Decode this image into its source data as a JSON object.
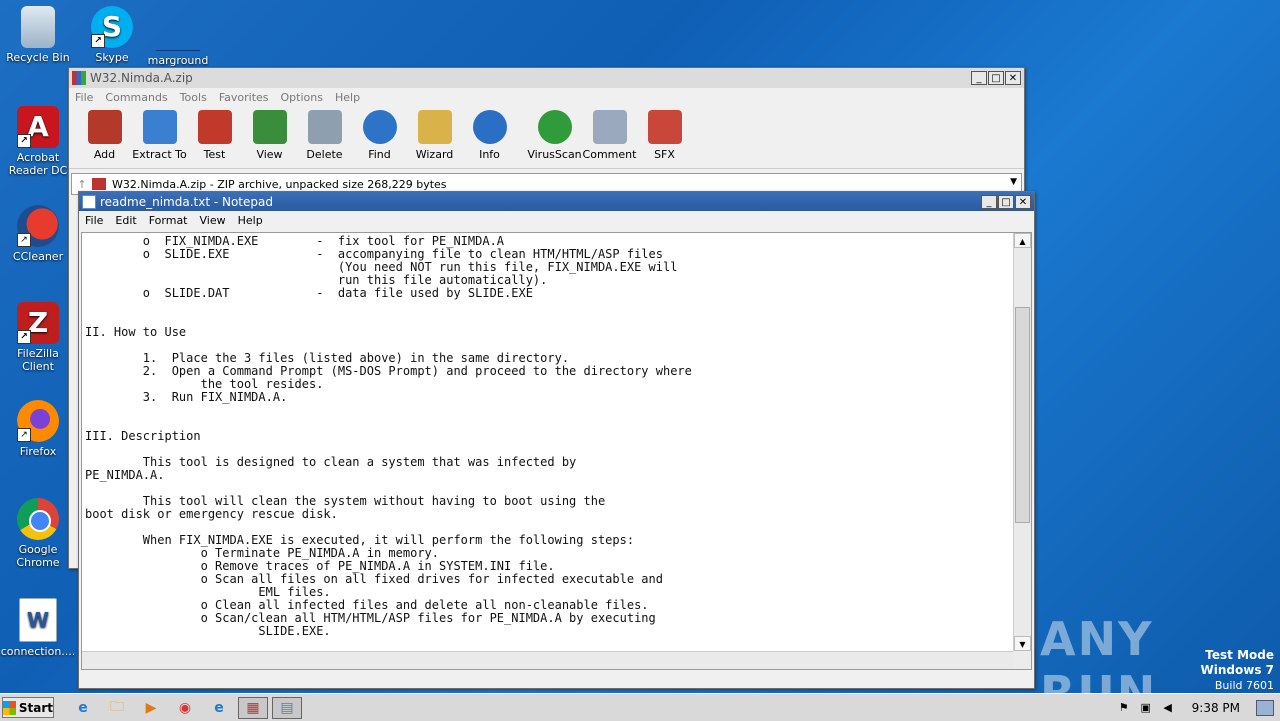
{
  "desktop_icons": [
    {
      "label": "Recycle Bin",
      "icon": "recycle-bin-icon"
    },
    {
      "label": "Skype",
      "icon": "skype-icon"
    },
    {
      "label": "marground",
      "icon": "file-icon"
    },
    {
      "label": "Acrobat Reader DC",
      "icon": "acrobat-icon"
    },
    {
      "label": "CCleaner",
      "icon": "ccleaner-icon"
    },
    {
      "label": "FileZilla Client",
      "icon": "filezilla-icon"
    },
    {
      "label": "Firefox",
      "icon": "firefox-icon"
    },
    {
      "label": "Google Chrome",
      "icon": "chrome-icon"
    },
    {
      "label": "connection....",
      "icon": "word-document-icon"
    }
  ],
  "winrar": {
    "title": "W32.Nimda.A.zip",
    "menu": [
      "File",
      "Commands",
      "Tools",
      "Favorites",
      "Options",
      "Help"
    ],
    "tools": [
      {
        "label": "Add",
        "color": "#b33a2b"
      },
      {
        "label": "Extract To",
        "color": "#3b7fd1"
      },
      {
        "label": "Test",
        "color": "#c0392b"
      },
      {
        "label": "View",
        "color": "#3a8d3a"
      },
      {
        "label": "Delete",
        "color": "#8ea0b0"
      },
      {
        "label": "Find",
        "color": "#2d74c9"
      },
      {
        "label": "Wizard",
        "color": "#d9b24a"
      },
      {
        "label": "Info",
        "color": "#2a6fc4"
      },
      {
        "label": "VirusScan",
        "color": "#2f9b3a"
      },
      {
        "label": "Comment",
        "color": "#9aa9bd"
      },
      {
        "label": "SFX",
        "color": "#c9463a"
      }
    ],
    "address": "W32.Nimda.A.zip - ZIP archive, unpacked size 268,229 bytes"
  },
  "notepad": {
    "title": "readme_nimda.txt - Notepad",
    "menu": [
      "File",
      "Edit",
      "Format",
      "View",
      "Help"
    ],
    "content": "        o  FIX_NIMDA.EXE        -  fix tool for PE_NIMDA.A\n        o  SLIDE.EXE            -  accompanying file to clean HTM/HTML/ASP files\n                                   (You need NOT run this file, FIX_NIMDA.EXE will\n                                   run this file automatically).\n        o  SLIDE.DAT            -  data file used by SLIDE.EXE\n\n\nII. How to Use\n\n        1.  Place the 3 files (listed above) in the same directory.\n        2.  Open a Command Prompt (MS-DOS Prompt) and proceed to the directory where\n                the tool resides.\n        3.  Run FIX_NIMDA.A.\n\n\nIII. Description\n\n        This tool is designed to clean a system that was infected by\nPE_NIMDA.A.\n\n        This tool will clean the system without having to boot using the\nboot disk or emergency rescue disk.\n\n        When FIX_NIMDA.EXE is executed, it will perform the following steps:\n                o Terminate PE_NIMDA.A in memory.\n                o Remove traces of PE_NIMDA.A in SYSTEM.INI file.\n                o Scan all files on all fixed drives for infected executable and\n                        EML files.\n                o Clean all infected files and delete all non-cleanable files.\n                o Scan/clean all HTM/HTML/ASP files for PE_NIMDA.A by executing\n                        SLIDE.EXE."
  },
  "watermark": "ANY RUN",
  "test_mode": {
    "line1": "Test Mode",
    "line2": "Windows 7",
    "line3": "Build 7601"
  },
  "taskbar": {
    "start_label": "Start",
    "apps": [
      {
        "name": "ie-icon",
        "glyph": "e",
        "active": false
      },
      {
        "name": "explorer-icon",
        "glyph": "🗀",
        "active": false
      },
      {
        "name": "media-player-icon",
        "glyph": "▶",
        "active": false
      },
      {
        "name": "chrome-icon",
        "glyph": "◉",
        "active": false
      },
      {
        "name": "edge-icon",
        "glyph": "e",
        "active": false
      },
      {
        "name": "winrar-icon",
        "glyph": "▦",
        "active": true
      },
      {
        "name": "notepad-icon",
        "glyph": "▤",
        "active": true
      }
    ],
    "clock": "9:38 PM"
  }
}
